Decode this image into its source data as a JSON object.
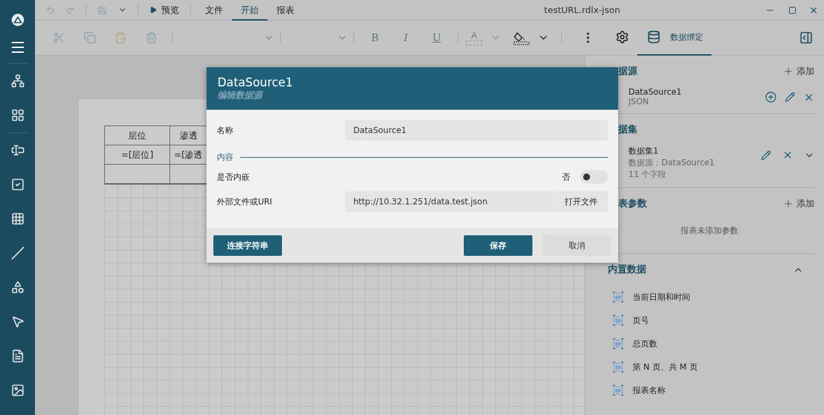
{
  "window": {
    "title": "testURL.rdlx-json"
  },
  "quick_actions": {
    "preview": "预览"
  },
  "menu_tabs": [
    {
      "label": "文件",
      "selected": false
    },
    {
      "label": "开始",
      "selected": true
    },
    {
      "label": "报表",
      "selected": false
    }
  ],
  "toolbar": {
    "format": [
      "B",
      "I",
      "U"
    ],
    "font_color": "A"
  },
  "panel_tabs": [
    {
      "kind": "settings",
      "selected": false
    },
    {
      "kind": "data",
      "label": "数据绑定",
      "selected": true
    }
  ],
  "report": {
    "table": {
      "header": [
        "层位",
        "渗透"
      ],
      "row": [
        "=[层位]",
        "=[渗透"
      ]
    }
  },
  "right_panel": {
    "data_sources": {
      "title": "据源",
      "add": "添加",
      "items": [
        {
          "name": "DataSource1",
          "type": "JSON"
        }
      ]
    },
    "datasets": {
      "title": "据集",
      "items": [
        {
          "name": "数据集1",
          "source": "数据源：DataSource1",
          "fields": "11 个字段"
        }
      ]
    },
    "parameters": {
      "title": "表参数",
      "add": "添加",
      "empty": "报表未添加参数"
    },
    "builtin": {
      "title": "内置数据",
      "expanded": true,
      "items": [
        "当前日期和时间",
        "页号",
        "总页数",
        "第 N 页、共 M 页",
        "报表名称"
      ]
    }
  },
  "dialog": {
    "title": "DataSource1",
    "subtitle": "编辑数据源",
    "name": {
      "label": "名称",
      "value": "DataSource1"
    },
    "section": "内容",
    "embed": {
      "label": "是否内嵌",
      "state": "否",
      "on": false
    },
    "uri": {
      "label": "外部文件或URI",
      "value": "http://10.32.1.251/data.test.json",
      "button": "打开文件"
    },
    "buttons": [
      {
        "label": "连接字符串",
        "kind": "primary"
      },
      {
        "label": "保存",
        "kind": "primary"
      },
      {
        "label": "取消",
        "kind": "secondary"
      }
    ]
  }
}
